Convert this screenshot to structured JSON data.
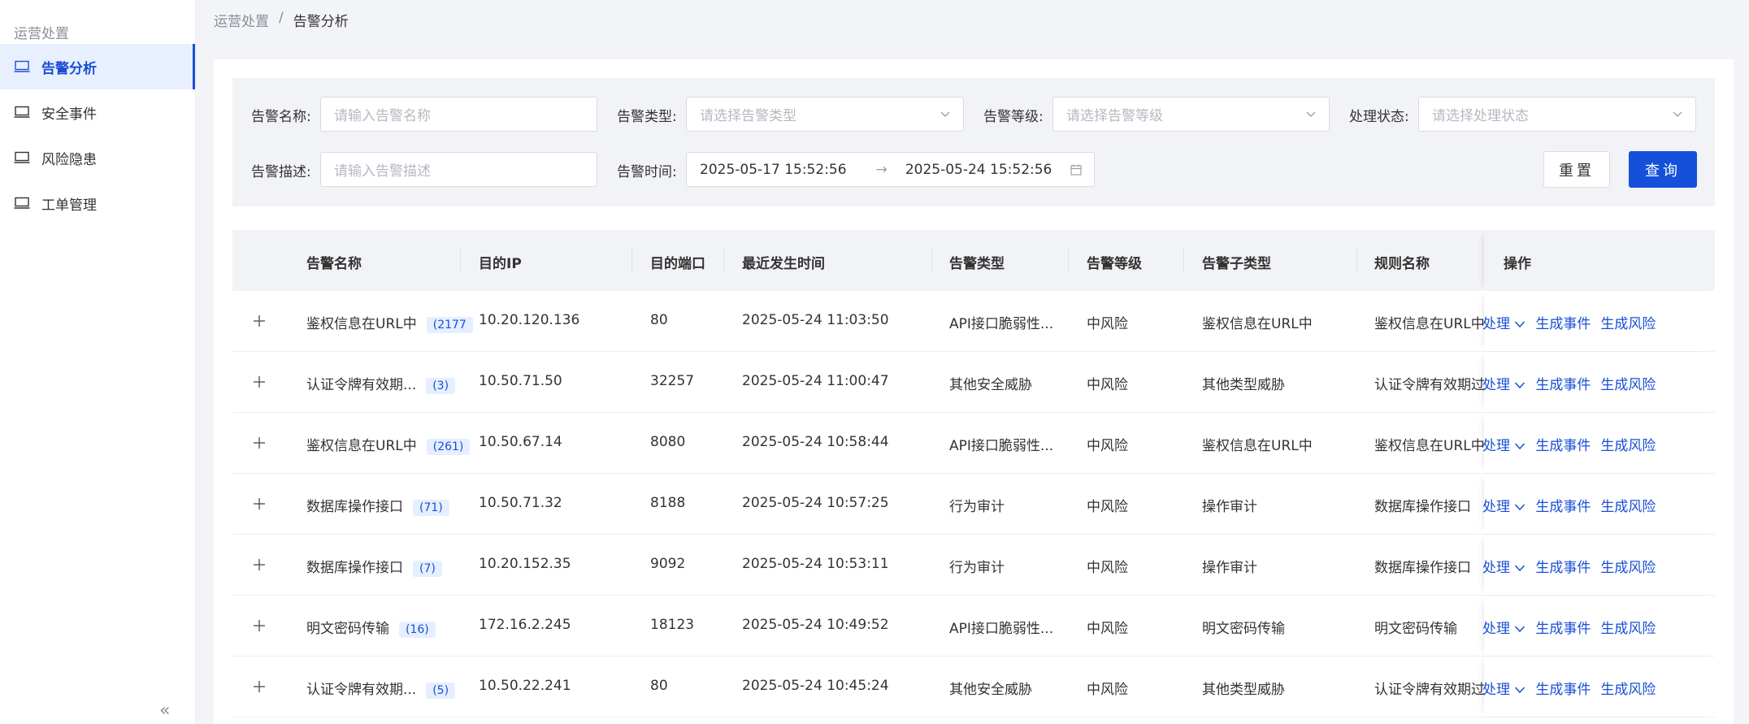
{
  "sidebar": {
    "section_title": "运营处置",
    "items": [
      {
        "label": "告警分析",
        "icon": "monitor-icon",
        "active": true
      },
      {
        "label": "安全事件",
        "icon": "monitor-icon",
        "active": false
      },
      {
        "label": "风险隐患",
        "icon": "monitor-icon",
        "active": false
      },
      {
        "label": "工单管理",
        "icon": "monitor-icon",
        "active": false
      }
    ],
    "collapse_glyph": "«"
  },
  "breadcrumb": {
    "parent": "运营处置",
    "separator": "/",
    "current": "告警分析"
  },
  "filters": {
    "alert_name": {
      "label": "告警名称:",
      "placeholder": "请输入告警名称"
    },
    "alert_type": {
      "label": "告警类型:",
      "placeholder": "请选择告警类型"
    },
    "alert_level": {
      "label": "告警等级:",
      "placeholder": "请选择告警等级"
    },
    "status": {
      "label": "处理状态:",
      "placeholder": "请选择处理状态"
    },
    "alert_desc": {
      "label": "告警描述:",
      "placeholder": "请输入告警描述"
    },
    "alert_time": {
      "label": "告警时间:",
      "start": "2025-05-17 15:52:56",
      "arrow": "→",
      "end": "2025-05-24 15:52:56"
    },
    "reset_label": "重置",
    "query_label": "查询"
  },
  "table": {
    "columns": [
      "告警名称",
      "目的IP",
      "目的端口",
      "最近发生时间",
      "告警类型",
      "告警等级",
      "告警子类型",
      "规则名称",
      "操作"
    ],
    "actions": [
      "处理",
      "生成事件",
      "生成风险"
    ],
    "rows": [
      {
        "name": "鉴权信息在URL中",
        "count": "(2177",
        "ip": "10.20.120.136",
        "port": "80",
        "time": "2025-05-24 11:03:50",
        "type": "API接口脆弱性...",
        "level": "中风险",
        "subtype": "鉴权信息在URL中",
        "rule": "鉴权信息在URL中"
      },
      {
        "name": "认证令牌有效期...",
        "count": "(3)",
        "ip": "10.50.71.50",
        "port": "32257",
        "time": "2025-05-24 11:00:47",
        "type": "其他安全威胁",
        "level": "中风险",
        "subtype": "其他类型威胁",
        "rule": "认证令牌有效期过"
      },
      {
        "name": "鉴权信息在URL中",
        "count": "(261)",
        "ip": "10.50.67.14",
        "port": "8080",
        "time": "2025-05-24 10:58:44",
        "type": "API接口脆弱性...",
        "level": "中风险",
        "subtype": "鉴权信息在URL中",
        "rule": "鉴权信息在URL中"
      },
      {
        "name": "数据库操作接口",
        "count": "(71)",
        "ip": "10.50.71.32",
        "port": "8188",
        "time": "2025-05-24 10:57:25",
        "type": "行为审计",
        "level": "中风险",
        "subtype": "操作审计",
        "rule": "数据库操作接口"
      },
      {
        "name": "数据库操作接口",
        "count": "(7)",
        "ip": "10.20.152.35",
        "port": "9092",
        "time": "2025-05-24 10:53:11",
        "type": "行为审计",
        "level": "中风险",
        "subtype": "操作审计",
        "rule": "数据库操作接口"
      },
      {
        "name": "明文密码传输",
        "count": "(16)",
        "ip": "172.16.2.245",
        "port": "18123",
        "time": "2025-05-24 10:49:52",
        "type": "API接口脆弱性...",
        "level": "中风险",
        "subtype": "明文密码传输",
        "rule": "明文密码传输"
      },
      {
        "name": "认证令牌有效期...",
        "count": "(5)",
        "ip": "10.50.22.241",
        "port": "80",
        "time": "2025-05-24 10:45:24",
        "type": "其他安全威胁",
        "level": "中风险",
        "subtype": "其他类型威胁",
        "rule": "认证令牌有效期过"
      }
    ]
  },
  "colors": {
    "primary": "#1450d9",
    "accent_bg": "#e8f0ff"
  }
}
